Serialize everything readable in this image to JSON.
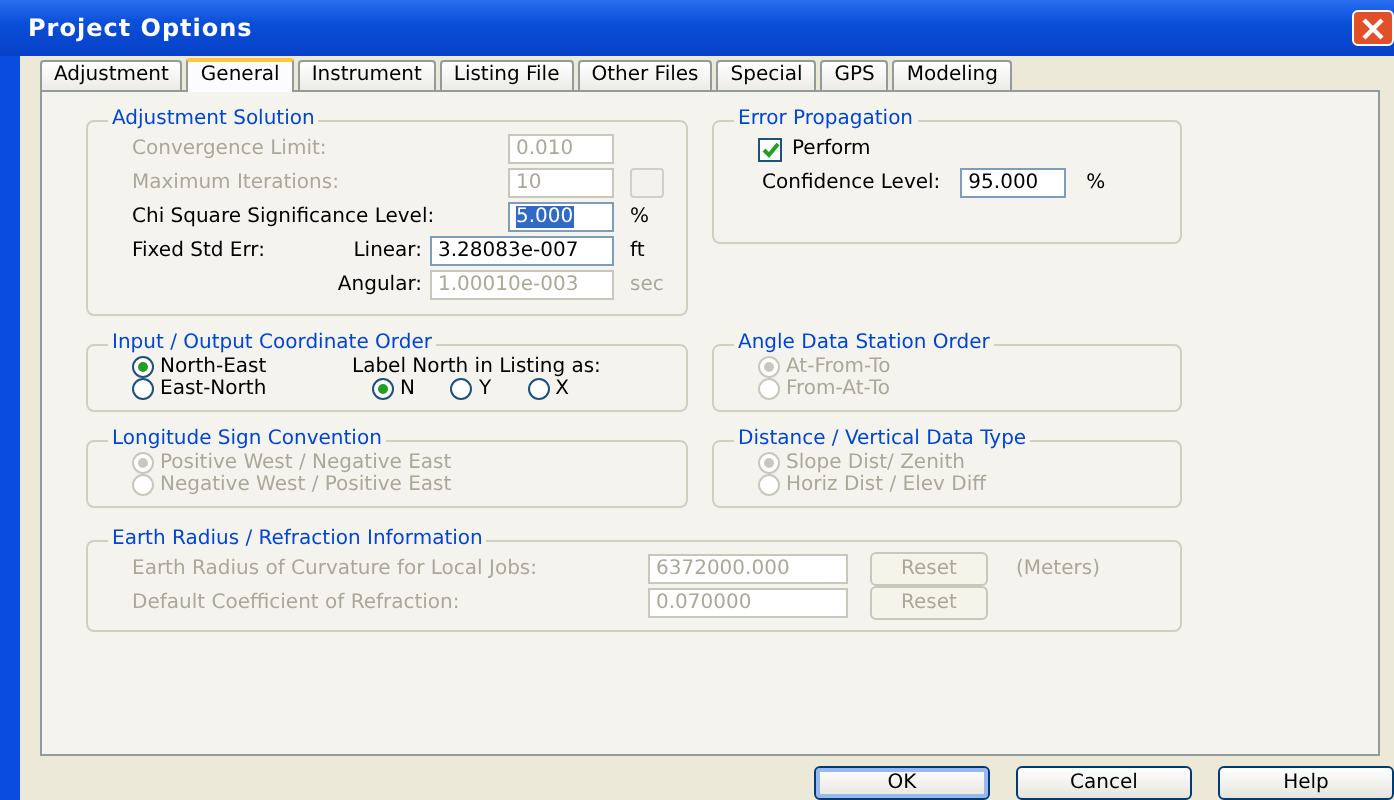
{
  "window": {
    "title": "Project Options"
  },
  "tabs": [
    {
      "label": "Adjustment",
      "selected": false
    },
    {
      "label": "General",
      "selected": true
    },
    {
      "label": "Instrument",
      "selected": false
    },
    {
      "label": "Listing File",
      "selected": false
    },
    {
      "label": "Other Files",
      "selected": false
    },
    {
      "label": "Special",
      "selected": false
    },
    {
      "label": "GPS",
      "selected": false
    },
    {
      "label": "Modeling",
      "selected": false
    }
  ],
  "adjustment_solution": {
    "title": "Adjustment Solution",
    "convergence_limit": {
      "label": "Convergence Limit:",
      "value": "0.010",
      "disabled": true
    },
    "maximum_iterations": {
      "label": "Maximum Iterations:",
      "value": "10",
      "disabled": true
    },
    "chi_square": {
      "label": "Chi Square Significance Level:",
      "value": "5.000",
      "unit": "%",
      "disabled": false,
      "text_selected": true
    },
    "fixed_std_err": {
      "label": "Fixed Std Err:",
      "linear": {
        "label": "Linear:",
        "value": "3.28083e-007",
        "unit": "ft",
        "disabled": false
      },
      "angular": {
        "label": "Angular:",
        "value": "1.00010e-003",
        "unit": "sec",
        "disabled": true
      }
    }
  },
  "error_propagation": {
    "title": "Error Propagation",
    "perform": {
      "label": "Perform",
      "checked": true
    },
    "confidence_level": {
      "label": "Confidence Level:",
      "value": "95.000",
      "unit": "%",
      "disabled": false
    }
  },
  "coordinate_order": {
    "title": "Input / Output Coordinate Order",
    "options": [
      {
        "label": "North-East",
        "selected": true
      },
      {
        "label": "East-North",
        "selected": false
      }
    ],
    "label_north": {
      "label": "Label North in Listing as:",
      "options": [
        {
          "label": "N",
          "selected": true
        },
        {
          "label": "Y",
          "selected": false
        },
        {
          "label": "X",
          "selected": false
        }
      ]
    }
  },
  "angle_data_station_order": {
    "title": "Angle Data Station Order",
    "disabled": true,
    "options": [
      {
        "label": "At-From-To",
        "selected": true
      },
      {
        "label": "From-At-To",
        "selected": false
      }
    ]
  },
  "longitude_sign_convention": {
    "title": "Longitude Sign Convention",
    "disabled": true,
    "options": [
      {
        "label": "Positive West / Negative East",
        "selected": true
      },
      {
        "label": "Negative West / Positive East",
        "selected": false
      }
    ]
  },
  "distance_vertical_data_type": {
    "title": "Distance / Vertical Data Type",
    "disabled": true,
    "options": [
      {
        "label": "Slope Dist/ Zenith",
        "selected": true
      },
      {
        "label": "Horiz Dist / Elev Diff",
        "selected": false
      }
    ]
  },
  "earth_radius": {
    "title": "Earth Radius / Refraction Information",
    "disabled": true,
    "rows": [
      {
        "label": "Earth Radius of Curvature for Local Jobs:",
        "value": "6372000.000",
        "button": "Reset",
        "unit": "(Meters)"
      },
      {
        "label": "Default Coefficient of Refraction:",
        "value": "0.070000",
        "button": "Reset"
      }
    ]
  },
  "buttons": [
    {
      "label": "OK",
      "default": true
    },
    {
      "label": "Cancel",
      "default": false
    },
    {
      "label": "Help",
      "default": false
    }
  ]
}
